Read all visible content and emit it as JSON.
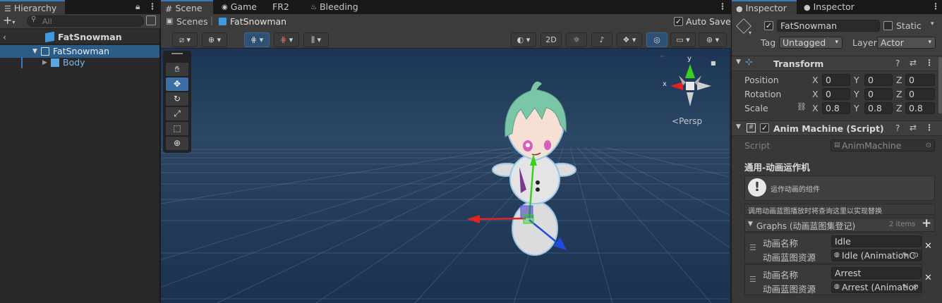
{
  "hierarchy": {
    "tab_label": "Hierarchy",
    "search_placeholder": "All",
    "scene_header": "FatSnowman",
    "items": [
      {
        "label": "FatSnowman"
      },
      {
        "label": "Body"
      }
    ]
  },
  "scene": {
    "tabs": [
      {
        "label": "Scene"
      },
      {
        "label": "Game"
      },
      {
        "label": "FR2"
      },
      {
        "label": "Bleeding"
      }
    ],
    "breadcrumb": {
      "root": "Scenes",
      "object": "FatSnowman"
    },
    "auto_save_label": "Auto Save",
    "auto_save_checked": true,
    "mode_2d_label": "2D",
    "gizmo": {
      "axis_x": "x",
      "axis_y": "y",
      "projection": "Persp"
    }
  },
  "inspector": {
    "tabs": [
      {
        "label": "Inspector"
      },
      {
        "label": "Inspector"
      }
    ],
    "object_name": "FatSnowman",
    "static_label": "Static",
    "tag_label": "Tag",
    "tag_value": "Untagged",
    "layer_label": "Layer",
    "layer_value": "Actor",
    "transform": {
      "title": "Transform",
      "position_label": "Position",
      "rotation_label": "Rotation",
      "scale_label": "Scale",
      "axis_x": "X",
      "axis_y": "Y",
      "axis_z": "Z",
      "position": {
        "x": "0",
        "y": "0",
        "z": "0"
      },
      "rotation": {
        "x": "0",
        "y": "0",
        "z": "0"
      },
      "scale": {
        "x": "0.8",
        "y": "0.8",
        "z": "0.8"
      }
    },
    "anim": {
      "title": "Anim Machine (Script)",
      "script_label": "Script",
      "script_value": "AnimMachine",
      "section_title": "通用-动画运作机",
      "info_text": "运作动画的组件",
      "hint_text": "调用动画蓝图播放时将查询这里以实现替换",
      "graphs_label": "Graphs (动画蓝图集登记)",
      "graphs_count": "2 items",
      "entries": [
        {
          "name_label": "动画名称",
          "name_value": "Idle",
          "asset_label": "动画蓝图资源",
          "asset_value": "Idle (AnimationC"
        },
        {
          "name_label": "动画名称",
          "name_value": "Arrest",
          "asset_label": "动画蓝图资源",
          "asset_value": "Arrest (Animatior"
        }
      ]
    }
  },
  "colors": {
    "accent": "#3a79bb",
    "selection": "#2c5d87",
    "sky": "#1e3553",
    "x_axis": "#e02424",
    "y_axis": "#38d21e",
    "z_axis": "#1f4ce0"
  }
}
